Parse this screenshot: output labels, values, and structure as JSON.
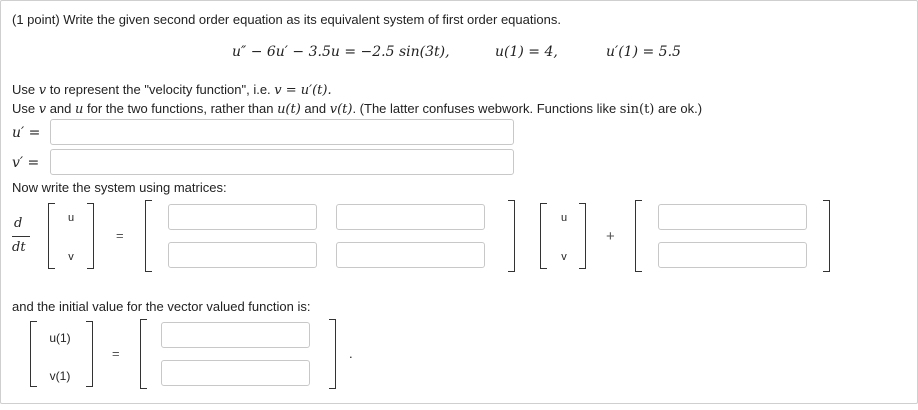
{
  "problem": {
    "header": "(1 point) Write the given second order equation as its equivalent system of first order equations.",
    "equation": "u″ − 6u′ − 3.5u = −2.5 sin(3t),",
    "ic1": "u(1) = 4,",
    "ic2": "u′(1) = 5.5"
  },
  "instructions": {
    "line1_pre": "Use ",
    "line1_var": "v",
    "line1_mid": " to represent the \"velocity function\", i.e. ",
    "line1_math": "v = u′(t).",
    "line2_pre": "Use ",
    "line2_v": "v",
    "line2_and": " and ",
    "line2_u": "u",
    "line2_mid": " for the two functions, rather than ",
    "line2_ut": "u(t)",
    "line2_and2": " and ",
    "line2_vt": "v(t)",
    "line2_post": ". (The latter confuses webwork. Functions like ",
    "line2_sin": "sin(t)",
    "line2_end": " are ok.)"
  },
  "answers": {
    "uprime_label": "u′ =",
    "vprime_label": "v′ =",
    "uprime_value": "",
    "vprime_value": ""
  },
  "matrix_section": {
    "prompt": "Now write the system using matrices:",
    "deriv_num": "d",
    "deriv_den": "dt",
    "vec_u": "u",
    "vec_v": "v",
    "equals": "=",
    "plus": "+"
  },
  "initial": {
    "prompt": "and the initial value for the vector valued function is:",
    "u1": "u(1)",
    "v1": "v(1)",
    "equals": "=",
    "period": "."
  }
}
